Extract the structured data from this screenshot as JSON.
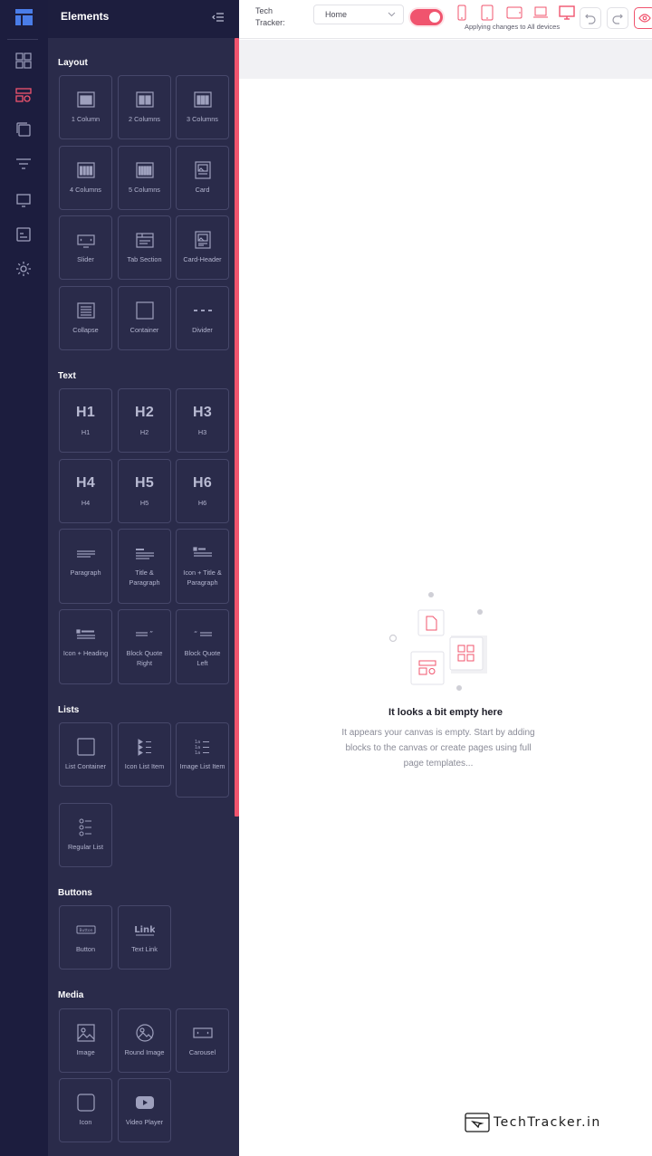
{
  "colors": {
    "accent": "#f0546e",
    "rail_bg": "#1c1d3e",
    "panel_bg": "#2a2b4a",
    "tile_border": "#46476a"
  },
  "rail": {
    "items": [
      {
        "icon": "dashboard-icon"
      },
      {
        "icon": "elements-icon",
        "active": true
      },
      {
        "icon": "pages-icon"
      },
      {
        "icon": "filter-icon"
      },
      {
        "icon": "monitor-icon"
      },
      {
        "icon": "media-icon"
      },
      {
        "icon": "settings-icon"
      }
    ]
  },
  "panel": {
    "title": "Elements",
    "sections": {
      "layout": {
        "title": "Layout",
        "items": [
          {
            "label": "1 Column",
            "icon": "one-column-icon"
          },
          {
            "label": "2 Columns",
            "icon": "two-columns-icon"
          },
          {
            "label": "3 Columns",
            "icon": "three-columns-icon"
          },
          {
            "label": "4 Columns",
            "icon": "four-columns-icon"
          },
          {
            "label": "5 Columns",
            "icon": "five-columns-icon"
          },
          {
            "label": "Card",
            "icon": "card-icon"
          },
          {
            "label": "Slider",
            "icon": "slider-icon"
          },
          {
            "label": "Tab Section",
            "icon": "tab-section-icon"
          },
          {
            "label": "Card-Header",
            "icon": "card-header-icon"
          },
          {
            "label": "Collapse",
            "icon": "collapse-icon"
          },
          {
            "label": "Container",
            "icon": "container-icon"
          },
          {
            "label": "Divider",
            "icon": "divider-icon"
          }
        ]
      },
      "text": {
        "title": "Text",
        "items": [
          {
            "label": "H1",
            "glyph": "H1"
          },
          {
            "label": "H2",
            "glyph": "H2"
          },
          {
            "label": "H3",
            "glyph": "H3"
          },
          {
            "label": "H4",
            "glyph": "H4"
          },
          {
            "label": "H5",
            "glyph": "H5"
          },
          {
            "label": "H6",
            "glyph": "H6"
          },
          {
            "label": "Paragraph",
            "icon": "paragraph-icon"
          },
          {
            "label": "Title & Paragraph",
            "icon": "title-paragraph-icon"
          },
          {
            "label": "Icon + Title & Paragraph",
            "icon": "icon-title-paragraph-icon"
          },
          {
            "label": "Icon + Heading",
            "icon": "icon-heading-icon"
          },
          {
            "label": "Block Quote Right",
            "icon": "block-quote-right-icon"
          },
          {
            "label": "Block Quote Left",
            "icon": "block-quote-left-icon"
          }
        ]
      },
      "lists": {
        "title": "Lists",
        "items": [
          {
            "label": "List Container",
            "icon": "list-container-icon"
          },
          {
            "label": "Icon List Item",
            "icon": "icon-list-item-icon"
          },
          {
            "label": "Image List Item",
            "icon": "image-list-item-icon"
          },
          {
            "label": "Regular List",
            "icon": "regular-list-icon"
          }
        ]
      },
      "buttons": {
        "title": "Buttons",
        "items": [
          {
            "label": "Button",
            "icon": "button-icon",
            "glyph": "Button"
          },
          {
            "label": "Text Link",
            "icon": "text-link-icon",
            "glyph": "Link"
          }
        ]
      },
      "media": {
        "title": "Media",
        "items": [
          {
            "label": "Image",
            "icon": "image-icon"
          },
          {
            "label": "Round Image",
            "icon": "round-image-icon"
          },
          {
            "label": "Carousel",
            "icon": "carousel-icon"
          },
          {
            "label": "Icon",
            "icon": "icon-element-icon"
          },
          {
            "label": "Video Player",
            "icon": "video-player-icon"
          }
        ]
      }
    }
  },
  "topbar": {
    "site_label": "Tech Tracker:",
    "page_select": "Home",
    "apply_note": "Applying changes to All devices",
    "devices": [
      "mobile-icon",
      "tablet-icon",
      "tablet-landscape-icon",
      "laptop-icon",
      "desktop-icon"
    ]
  },
  "canvas": {
    "empty_title": "It looks a bit empty here",
    "empty_desc": "It appears your canvas is empty. Start by adding blocks to the canvas or create pages using full page templates..."
  },
  "watermark": "TechTracker.in"
}
